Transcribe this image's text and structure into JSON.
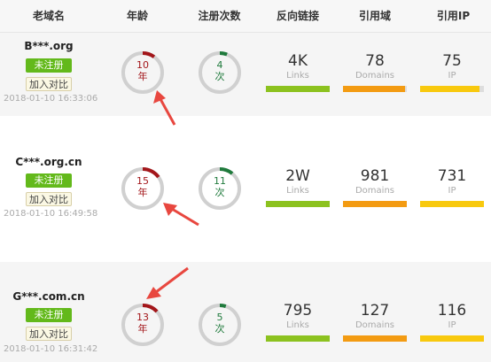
{
  "headers": {
    "domain": "老域名",
    "age": "年龄",
    "reg_count": "注册次数",
    "backlinks": "反向链接",
    "ref_domains": "引用域",
    "ref_ip": "引用IP"
  },
  "rows": [
    {
      "domain": "B***.org",
      "status": "未注册",
      "compare": "加入对比",
      "date": "2018-01-10 16:33:06",
      "age": "10",
      "age_unit": "年",
      "age_level": 0.1,
      "reg": "4",
      "reg_unit": "次",
      "reg_level": 0.06,
      "links": "4K",
      "links_label": "Links",
      "links_level": 1.0,
      "domains": "78",
      "domains_label": "Domains",
      "domains_level": 0.97,
      "ip": "75",
      "ip_label": "IP",
      "ip_level": 0.93
    },
    {
      "domain": "C***.org.cn",
      "status": "未注册",
      "compare": "加入对比",
      "date": "2018-01-10 16:49:58",
      "age": "15",
      "age_unit": "年",
      "age_level": 0.15,
      "reg": "11",
      "reg_unit": "次",
      "reg_level": 0.11,
      "links": "2W",
      "links_label": "Links",
      "links_level": 1.0,
      "domains": "981",
      "domains_label": "Domains",
      "domains_level": 1.0,
      "ip": "731",
      "ip_label": "IP",
      "ip_level": 1.0
    },
    {
      "domain": "G***.com.cn",
      "status": "未注册",
      "compare": "加入对比",
      "date": "2018-01-10 16:31:42",
      "age": "13",
      "age_unit": "年",
      "age_level": 0.13,
      "reg": "5",
      "reg_unit": "次",
      "reg_level": 0.05,
      "links": "795",
      "links_label": "Links",
      "links_level": 1.0,
      "domains": "127",
      "domains_label": "Domains",
      "domains_level": 1.0,
      "ip": "116",
      "ip_label": "IP",
      "ip_level": 1.0
    }
  ],
  "colors": {
    "age_ring": "#a3161a",
    "reg_ring": "#1f7a3c",
    "ring_track": "#d0d0d0",
    "links_bar": "#8cc21f",
    "domains_bar": "#f39b12",
    "ip_bar": "#f8c90e",
    "arrow": "#e8473f"
  }
}
